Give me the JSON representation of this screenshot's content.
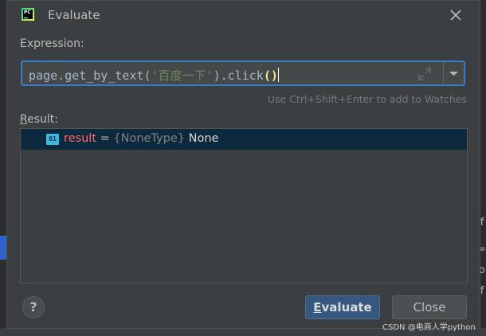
{
  "window": {
    "title": "Evaluate"
  },
  "expression": {
    "label": "Expression:",
    "code_prefix": "page.get_by_text(",
    "code_string": "'百度一下'",
    "code_mid": ").click",
    "code_parens": "()",
    "hint": "Use Ctrl+Shift+Enter to add to Watches"
  },
  "result": {
    "label_mnemonic": "R",
    "label_rest": "esult:",
    "icon_text": "01",
    "name": "result",
    "equals": " = ",
    "type": "{NoneType}",
    "value": " None"
  },
  "buttons": {
    "help": "?",
    "evaluate_mnemonic": "E",
    "evaluate_first": "",
    "evaluate_rest": "valuate",
    "close": "Close"
  },
  "background": {
    "editor_lines": [
      "f",
      "=",
      "o",
      "f-"
    ]
  },
  "watermark": "CSDN @电商人学python",
  "colors": {
    "dialog_bg": "#3c3f41",
    "selection": "#0d293e",
    "focus_border": "#3d7cc4",
    "primary_button": "#365880",
    "result_name": "#ff6b68",
    "string_literal": "#6a8759"
  },
  "icons": {
    "app": "pycharm-logo-icon",
    "close": "close-icon",
    "expand": "expand-icon",
    "dropdown": "chevron-down-icon",
    "variable": "variable-icon",
    "help": "help-icon"
  }
}
